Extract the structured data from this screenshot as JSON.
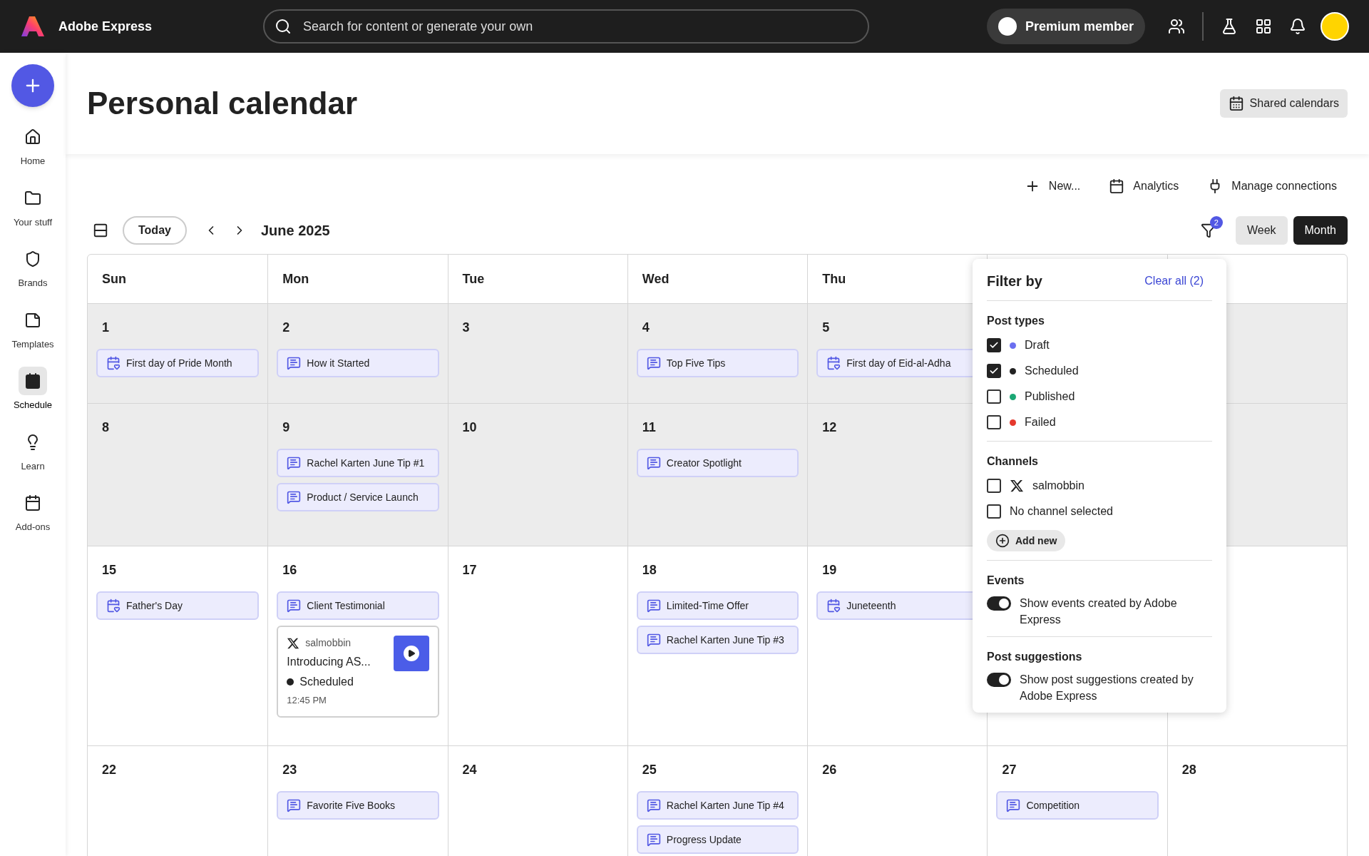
{
  "app": {
    "name": "Adobe Express"
  },
  "search": {
    "placeholder": "Search for content or generate your own"
  },
  "premium": {
    "label": "Premium member"
  },
  "sidebar": {
    "items": [
      {
        "label": "Home",
        "selected": false
      },
      {
        "label": "Your stuff",
        "selected": false
      },
      {
        "label": "Brands",
        "selected": false
      },
      {
        "label": "Templates",
        "selected": false
      },
      {
        "label": "Schedule",
        "selected": true
      },
      {
        "label": "Learn",
        "selected": false
      },
      {
        "label": "Add-ons",
        "selected": false
      }
    ]
  },
  "page": {
    "title": "Personal calendar",
    "shared_button": "Shared calendars"
  },
  "toolbar": [
    {
      "label": "New..."
    },
    {
      "label": "Analytics"
    },
    {
      "label": "Manage connections"
    }
  ],
  "nav": {
    "today": "Today",
    "month": "June 2025",
    "filter_count": "2",
    "views": [
      {
        "label": "Week",
        "selected": false
      },
      {
        "label": "Month",
        "selected": true
      }
    ]
  },
  "calendar": {
    "headers": [
      "Sun",
      "Mon",
      "Tue",
      "Wed",
      "Thu"
    ],
    "weeks": [
      {
        "past": true,
        "days": [
          {
            "date": "1",
            "items": [
              {
                "kind": "event",
                "label": "First day of Pride Month"
              }
            ]
          },
          {
            "date": "2",
            "items": [
              {
                "kind": "suggestion",
                "label": "How it Started"
              }
            ]
          },
          {
            "date": "3"
          },
          {
            "date": "4",
            "items": [
              {
                "kind": "suggestion",
                "label": "Top Five Tips"
              }
            ]
          },
          {
            "date": "5",
            "items": [
              {
                "kind": "event",
                "label": "First day of Eid-al-Adha"
              }
            ]
          }
        ]
      },
      {
        "past": true,
        "days": [
          {
            "date": "8"
          },
          {
            "date": "9",
            "items": [
              {
                "kind": "suggestion",
                "label": "Rachel Karten June Tip #1"
              },
              {
                "kind": "suggestion",
                "label": "Product / Service Launch"
              }
            ]
          },
          {
            "date": "10"
          },
          {
            "date": "11",
            "items": [
              {
                "kind": "suggestion",
                "label": "Creator Spotlight"
              }
            ]
          },
          {
            "date": "12"
          }
        ]
      },
      {
        "past": false,
        "days": [
          {
            "date": "15",
            "items": [
              {
                "kind": "event",
                "label": "Father's Day"
              }
            ]
          },
          {
            "date": "16",
            "items": [
              {
                "kind": "suggestion",
                "label": "Client Testimonial"
              },
              {
                "kind": "post",
                "account": "salmobbin",
                "label": "Introducing AS...",
                "status": "Scheduled",
                "time": "12:45 PM"
              }
            ]
          },
          {
            "date": "17"
          },
          {
            "date": "18",
            "items": [
              {
                "kind": "suggestion",
                "label": "Limited-Time Offer"
              },
              {
                "kind": "suggestion",
                "label": "Rachel Karten June Tip #3"
              }
            ]
          },
          {
            "date": "19",
            "items": [
              {
                "kind": "event",
                "label": "Juneteenth"
              }
            ]
          }
        ]
      },
      {
        "past": false,
        "days": [
          {
            "date": "22"
          },
          {
            "date": "23",
            "items": [
              {
                "kind": "suggestion",
                "label": "Favorite Five Books"
              }
            ]
          },
          {
            "date": "24"
          },
          {
            "date": "25",
            "items": [
              {
                "kind": "suggestion",
                "label": "Rachel Karten June Tip #4"
              },
              {
                "kind": "suggestion",
                "label": "Progress Update"
              }
            ]
          },
          {
            "date": "26"
          },
          {
            "date": "27",
            "items": [
              {
                "kind": "suggestion",
                "label": "Competition"
              }
            ]
          },
          {
            "date": "28"
          }
        ]
      }
    ]
  },
  "filter": {
    "title": "Filter by",
    "clear": "Clear all (2)",
    "post_types": {
      "title": "Post types",
      "items": [
        {
          "label": "Draft",
          "checked": true,
          "color": "#6b6ff0"
        },
        {
          "label": "Scheduled",
          "checked": true,
          "color": "#222222"
        },
        {
          "label": "Published",
          "checked": false,
          "color": "#1aa774"
        },
        {
          "label": "Failed",
          "checked": false,
          "color": "#e5382d"
        }
      ]
    },
    "channels": {
      "title": "Channels",
      "items": [
        {
          "label": "salmobbin",
          "kind": "x",
          "checked": false
        },
        {
          "label": "No channel selected",
          "kind": "none",
          "checked": false
        }
      ],
      "add": "Add new"
    },
    "events": {
      "title": "Events",
      "label": "Show events created by Adobe Express",
      "on": true
    },
    "suggestions": {
      "title": "Post suggestions",
      "label": "Show post suggestions created by Adobe Express",
      "on": true
    }
  }
}
